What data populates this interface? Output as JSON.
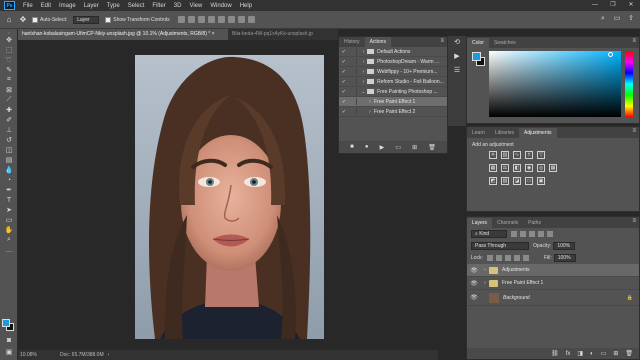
{
  "app": {
    "logo": "Ps",
    "menu": [
      "File",
      "Edit",
      "Image",
      "Layer",
      "Type",
      "Select",
      "Filter",
      "3D",
      "View",
      "Window",
      "Help"
    ],
    "window_controls": [
      "—",
      "❐",
      "✕"
    ]
  },
  "options_bar": {
    "auto_select_label": "Auto-Select:",
    "auto_select_value": "Layer",
    "show_transform_label": "Show Transform Controls"
  },
  "document_tabs": [
    {
      "title": "hanlshan-kobalasingam-UfimCP-Nkiy-unsplash.jpg @ 10.1% (Adjustments, RGB/8) *",
      "close": "×"
    },
    {
      "title": "Bila-beda-4W-pq1x4yKk-unsplash.jp",
      "close": ""
    }
  ],
  "status_bar": {
    "zoom": "10.08%",
    "doc": "Doc: 65.7M/388.0M"
  },
  "actions_panel": {
    "tabs": [
      "History",
      "Actions"
    ],
    "active_tab": "Actions",
    "items": [
      {
        "name": "Default Actions",
        "type": "folder",
        "selected": false
      },
      {
        "name": "PhotoshopDream - Warm ...",
        "type": "folder",
        "selected": false
      },
      {
        "name": "Webflippy - 10+ Premium...",
        "type": "folder",
        "selected": false
      },
      {
        "name": "Reform Studio - Foil Balloon...",
        "type": "folder",
        "selected": false
      },
      {
        "name": "Free Painting Photoshop ...",
        "type": "folder",
        "selected": false
      },
      {
        "name": "Free Paint Effect 1",
        "type": "action",
        "selected": true
      },
      {
        "name": "Free Paint Effect 2",
        "type": "action",
        "selected": false
      }
    ],
    "footer_icons": [
      "■",
      "●",
      "▶",
      "▭",
      "⊞",
      "🗑"
    ]
  },
  "color_panel": {
    "tabs": [
      "Color",
      "Swatches"
    ],
    "foreground": "#1a9de0",
    "background": "#111111"
  },
  "adjustments_panel": {
    "tabs": [
      "Learn",
      "Libraries",
      "Adjustments"
    ],
    "title": "Add an adjustment"
  },
  "layers_panel": {
    "tabs": [
      "Layers",
      "Channels",
      "Paths"
    ],
    "kind_label": "Kind",
    "blend_mode": "Pass Through",
    "opacity_label": "Opacity:",
    "opacity_value": "100%",
    "lock_label": "Lock:",
    "fill_label": "Fill:",
    "fill_value": "100%",
    "layers": [
      {
        "name": "Adjustments",
        "type": "group",
        "selected": true
      },
      {
        "name": "Free Paint Effect 1",
        "type": "group",
        "selected": false
      },
      {
        "name": "Background",
        "type": "image",
        "selected": false
      }
    ]
  }
}
